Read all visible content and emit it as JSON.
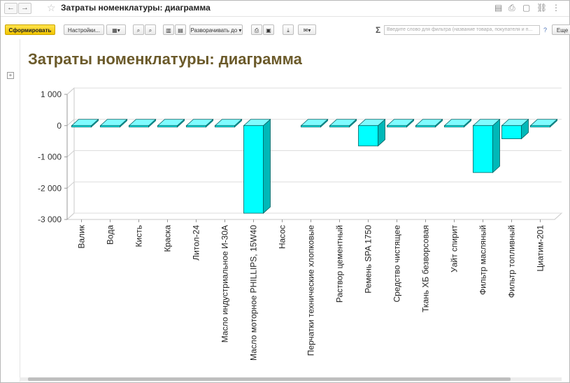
{
  "window": {
    "title": "Затраты номенклатуры: диаграмма",
    "nav_back": "←",
    "nav_forward": "→",
    "more": "⋮"
  },
  "toolbar": {
    "generate": "Сформировать",
    "settings": "Настройки...",
    "expand_to": "Разворачивать до",
    "search_placeholder": "Введите слово для фильтра (название товара, покупателя и п...",
    "help": "?",
    "more": "Еще"
  },
  "report": {
    "title": "Затраты номенклатуры: диаграмма"
  },
  "colors": {
    "bar_front": "#00ffff",
    "bar_top": "#7ffbff",
    "bar_side": "#00b8b8",
    "title": "#6b5a2a",
    "primary_button": "#f5c800"
  },
  "chart_data": {
    "type": "bar",
    "style": "3d",
    "ylim": [
      -3000,
      1000
    ],
    "yticks": [
      1000,
      0,
      -1000,
      -2000,
      -3000
    ],
    "ytick_labels": [
      "1 000",
      "0",
      "-1 000",
      "-2 000",
      "-3 000"
    ],
    "grid": true,
    "categories": [
      "Валик",
      "Вода",
      "Кисть",
      "Краска",
      "Литол-24",
      "Масло индустриальное И-30А",
      "Масло моторное PHILLIPS, 15W40",
      "Насос",
      "Перчатки технические хлопковые",
      "Раствор цементный",
      "Ремень SPA 1750",
      "Средство чистящее",
      "Ткань ХБ безворсовая",
      "Уайт спирит",
      "Фильтр масляный",
      "Фильтр топливный",
      "Циатим-201"
    ],
    "values": [
      -20,
      -10,
      -30,
      -30,
      -30,
      -30,
      -2800,
      0,
      -30,
      -40,
      -650,
      -5,
      -5,
      -5,
      -1500,
      -420,
      -5
    ]
  }
}
